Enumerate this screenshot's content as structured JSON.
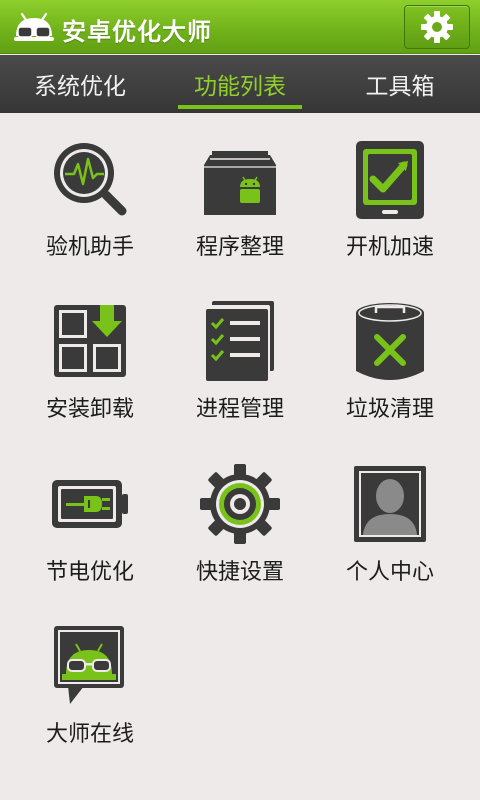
{
  "app": {
    "title": "安卓优化大师"
  },
  "tabs": [
    {
      "label": "系统优化"
    },
    {
      "label": "功能列表"
    },
    {
      "label": "工具箱"
    }
  ],
  "active_tab": 1,
  "features": [
    {
      "label": "验机助手",
      "icon": "magnifier-pulse-icon"
    },
    {
      "label": "程序整理",
      "icon": "android-box-icon"
    },
    {
      "label": "开机加速",
      "icon": "tablet-arrow-icon"
    },
    {
      "label": "安装卸载",
      "icon": "grid-download-icon"
    },
    {
      "label": "进程管理",
      "icon": "checklist-icon"
    },
    {
      "label": "垃圾清理",
      "icon": "trash-can-icon"
    },
    {
      "label": "节电优化",
      "icon": "battery-plug-icon"
    },
    {
      "label": "快捷设置",
      "icon": "gear-target-icon"
    },
    {
      "label": "个人中心",
      "icon": "profile-icon"
    },
    {
      "label": "大师在线",
      "icon": "android-chat-icon"
    }
  ],
  "colors": {
    "accent": "#79c21a",
    "titlebar": "#6fb11a",
    "tabbar": "#3f3f3f",
    "icon_dark": "#3a3a3a",
    "background": "#efeaea"
  }
}
